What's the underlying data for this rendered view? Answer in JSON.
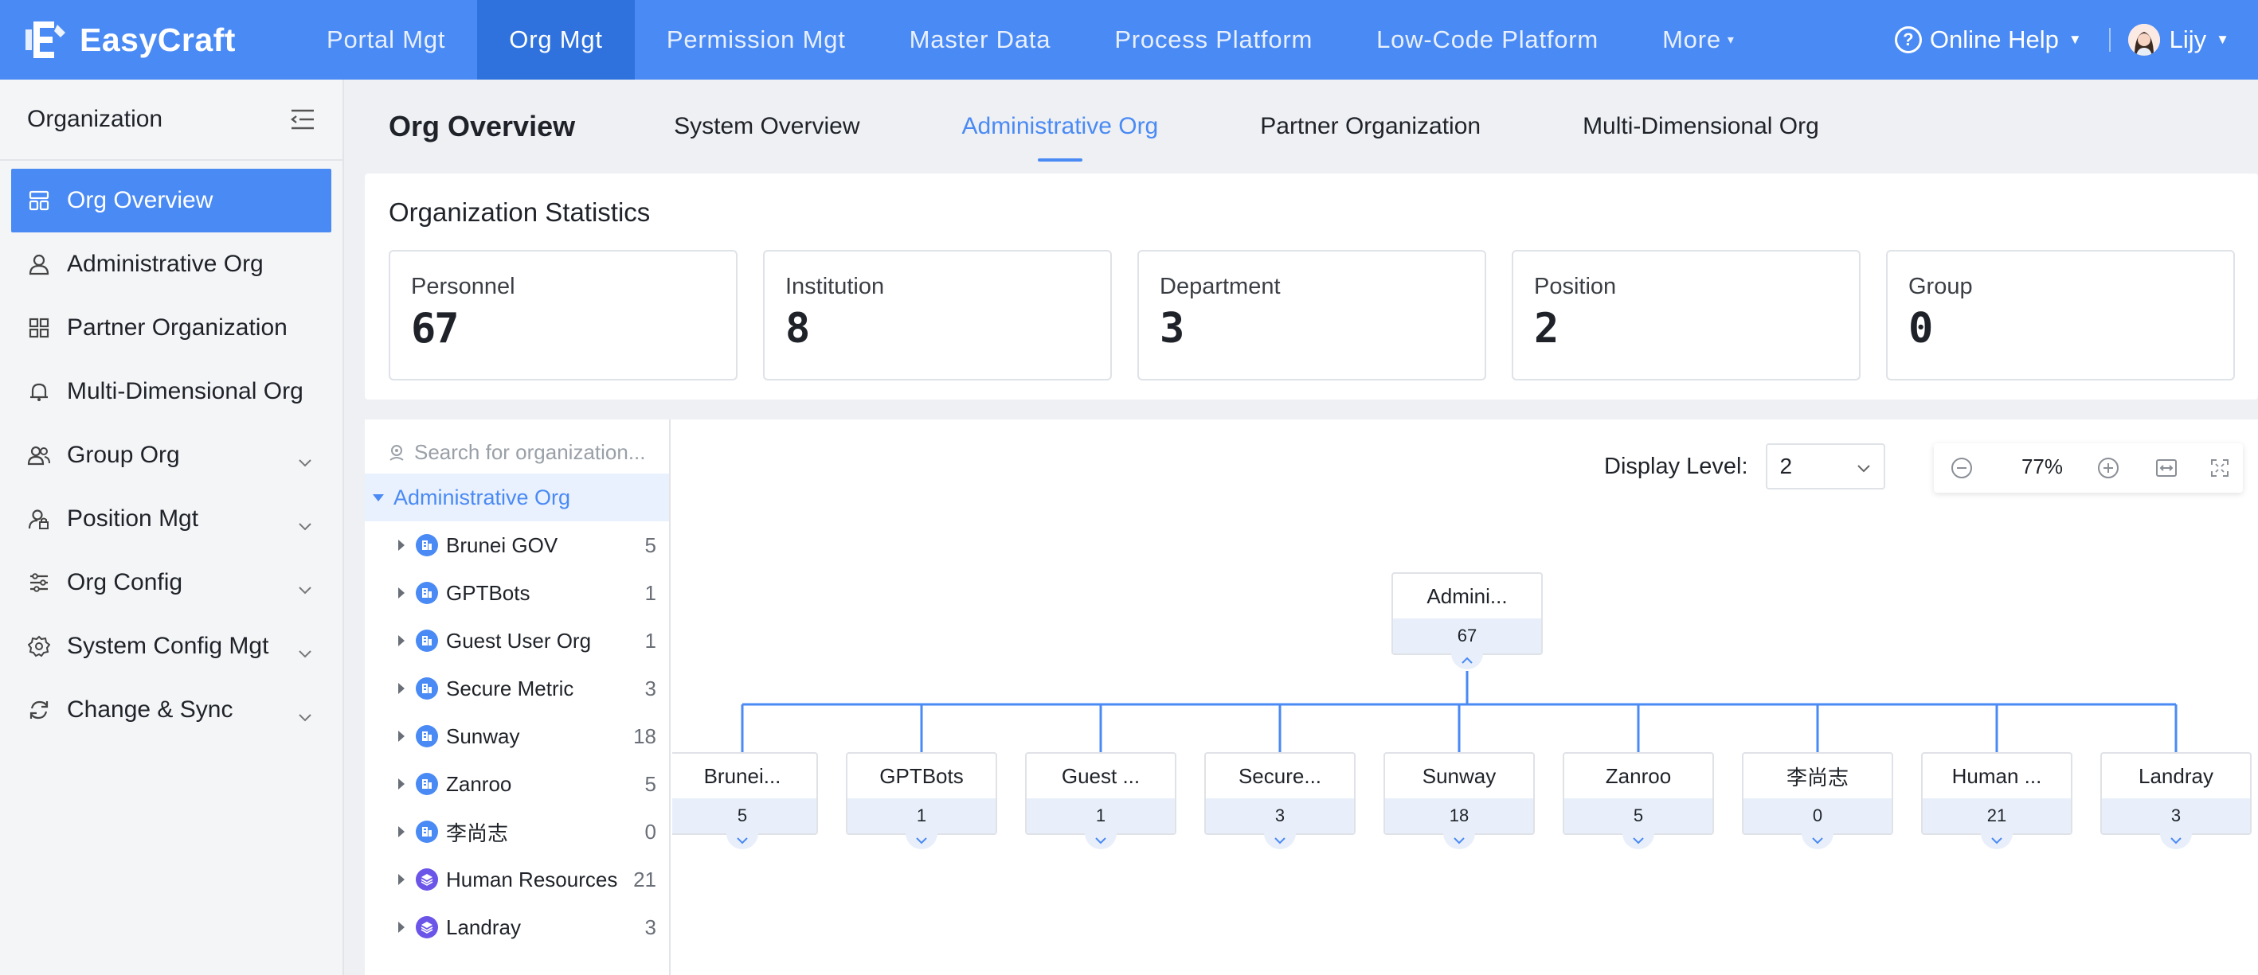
{
  "app": {
    "name": "EasyCraft"
  },
  "nav": {
    "items": [
      "Portal Mgt",
      "Org Mgt",
      "Permission Mgt",
      "Master Data",
      "Process Platform",
      "Low-Code Platform"
    ],
    "more": "More",
    "active": "Org Mgt"
  },
  "topright": {
    "help": "Online Help",
    "user": "Lijy"
  },
  "sidebar": {
    "title": "Organization",
    "items": [
      {
        "label": "Org Overview",
        "active": true
      },
      {
        "label": "Administrative Org"
      },
      {
        "label": "Partner Organization"
      },
      {
        "label": "Multi-Dimensional Org"
      },
      {
        "label": "Group Org",
        "expandable": true
      },
      {
        "label": "Position Mgt",
        "expandable": true
      },
      {
        "label": "Org Config",
        "expandable": true
      },
      {
        "label": "System Config Mgt",
        "expandable": true
      },
      {
        "label": "Change & Sync",
        "expandable": true
      }
    ]
  },
  "tabs": {
    "title": "Org Overview",
    "items": [
      "System Overview",
      "Administrative Org",
      "Partner Organization",
      "Multi-Dimensional Org"
    ],
    "active": "Administrative Org"
  },
  "stats": {
    "title": "Organization Statistics",
    "cards": [
      {
        "label": "Personnel",
        "value": "67"
      },
      {
        "label": "Institution",
        "value": "8"
      },
      {
        "label": "Department",
        "value": "3"
      },
      {
        "label": "Position",
        "value": "2"
      },
      {
        "label": "Group",
        "value": "0"
      }
    ]
  },
  "tree": {
    "search_placeholder": "Search for organization...",
    "root": "Administrative Org",
    "rows": [
      {
        "name": "Brunei GOV",
        "count": "5",
        "type": "institution"
      },
      {
        "name": "GPTBots",
        "count": "1",
        "type": "institution"
      },
      {
        "name": "Guest User Org",
        "count": "1",
        "type": "institution"
      },
      {
        "name": "Secure Metric",
        "count": "3",
        "type": "institution"
      },
      {
        "name": "Sunway",
        "count": "18",
        "type": "institution"
      },
      {
        "name": "Zanroo",
        "count": "5",
        "type": "institution"
      },
      {
        "name": "李尚志",
        "count": "0",
        "type": "institution"
      },
      {
        "name": "Human Resources",
        "count": "21",
        "type": "group"
      },
      {
        "name": "Landray",
        "count": "3",
        "type": "group"
      }
    ]
  },
  "chart_controls": {
    "display_level_label": "Display Level:",
    "display_level_value": "2",
    "zoom": "77%"
  },
  "org_chart": {
    "root": {
      "name": "Admini...",
      "count": "67"
    },
    "children": [
      {
        "name": "Brunei...",
        "count": "5"
      },
      {
        "name": "GPTBots",
        "count": "1"
      },
      {
        "name": "Guest ...",
        "count": "1"
      },
      {
        "name": "Secure...",
        "count": "3"
      },
      {
        "name": "Sunway",
        "count": "18"
      },
      {
        "name": "Zanroo",
        "count": "5"
      },
      {
        "name": "李尚志",
        "count": "0"
      },
      {
        "name": "Human ...",
        "count": "21"
      },
      {
        "name": "Landray",
        "count": "3"
      }
    ]
  },
  "colors": {
    "primary": "#4a8af4",
    "nav_active": "#2f72dd",
    "group_icon": "#6b54e8"
  }
}
